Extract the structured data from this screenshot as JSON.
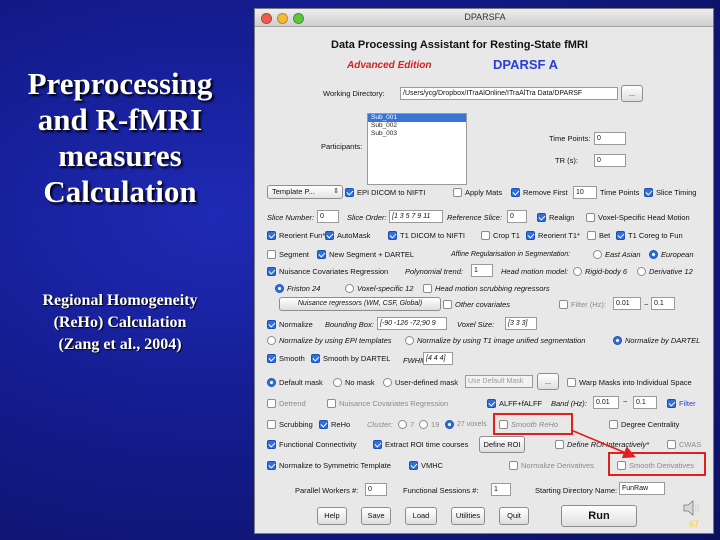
{
  "slide": {
    "title_lines": [
      "Preprocessing",
      "and R-fMRI",
      "measures",
      "Calculation"
    ],
    "subtitle_lines": [
      "Regional Homogeneity",
      "(ReHo) Calculation",
      "(Zang et al., 2004)"
    ],
    "page_number": "67"
  },
  "window": {
    "title": "DPARSFA",
    "header": "Data Processing Assistant for Resting-State fMRI",
    "edition": "Advanced Edition",
    "app_name": "DPARSF A",
    "colors": {
      "edition": "#d42020",
      "app_name": "#2a3fd6",
      "accent_check": "#2f6fe0",
      "highlight": "#e11f1f"
    }
  },
  "working_dir": {
    "label": "Working Directory:",
    "value": "/Users/ycg/Dropbox/ITraAlOnline/ITraAlTra Data/DPARSF",
    "browse": "..."
  },
  "participants": {
    "label": "Participants:",
    "items": [
      "Sub_001",
      "Sub_002",
      "Sub_003"
    ],
    "selected": 0
  },
  "time_points": {
    "label": "Time Points:",
    "value": "0"
  },
  "tr": {
    "label": "TR (s):",
    "value": "0"
  },
  "template": {
    "label": "Template P...",
    "icon": "chevron-updown-icon"
  },
  "row1": {
    "epi_dicom": "EPI DICOM to NIFTI",
    "apply_mats": "Apply Mats",
    "remove_first": "Remove First",
    "remove_value": "10",
    "time_points_lbl": "Time Points",
    "slice_timing": "Slice Timing"
  },
  "row2": {
    "slice_number": "Slice Number:",
    "slice_number_val": "0",
    "slice_order": "Slice Order:",
    "slice_order_val": "[1 3 5 7 9 11",
    "reference_slice": "Reference Slice:",
    "reference_val": "0",
    "realign": "Realign",
    "voxel_head": "Voxel-Specific Head Motion"
  },
  "row3": {
    "reorient_fun": "Reorient Fun*",
    "automask": "AutoMask",
    "t1_dicom": "T1 DICOM to NIFTI",
    "crop_t1": "Crop T1",
    "reorient_t1": "Reorient T1*",
    "bet": "Bet",
    "t1_coreg": "T1 Coreg to Fun"
  },
  "row4": {
    "segment": "Segment",
    "new_segment": "New Segment + DARTEL",
    "affine_label": "Affine Regularisation in Segmentation:",
    "east_asian": "East Asian",
    "european": "European"
  },
  "row5": {
    "nuisance": "Nuisance Covariates Regression",
    "polynomial": "Polynomial trend:",
    "poly_val": "1",
    "head_motion": "Head motion model:",
    "rigid6": "Rigid-body 6",
    "derivative12": "Derivative 12"
  },
  "row6": {
    "friston24": "Friston 24",
    "voxel12": "Voxel-specific 12",
    "head_scrub": "Head motion scrubbing regressors"
  },
  "row7": {
    "nuisance_regs": "Nuisance regressors (WM, CSF, Global)",
    "other_cov": "Other covariates",
    "filter": "Filter (Hz):",
    "filter_low": "0.01",
    "filter_sep": "~",
    "filter_high": "0.1"
  },
  "row8": {
    "normalize": "Normalize",
    "bounding_box": "Bounding Box:",
    "bbox_val": "[-90 -126 -72;90 9",
    "voxel_size": "Voxel Size:",
    "voxel_val": "[3 3 3]"
  },
  "row9": {
    "norm_epi": "Normalize by using EPI templates",
    "norm_t1": "Normalize by using T1 image unified segmentation",
    "norm_dartel": "Normalize by DARTEL"
  },
  "row10": {
    "smooth": "Smooth",
    "smooth_dartel": "Smooth by DARTEL",
    "fwhm": "FWHM:",
    "fwhm_val": "[4 4 4]"
  },
  "row11": {
    "default_mask": "Default mask",
    "no_mask": "No mask",
    "user_mask": "User-defined mask",
    "use_default": "Use Default Mask",
    "browse": "...",
    "warp": "Warp Masks into Individual Space"
  },
  "row12": {
    "detrend": "Detrend",
    "nuisance2": "Nuisance Covariates Regression",
    "alff": "ALFF+fALFF",
    "band": "Band (Hz):",
    "band_low": "0.01",
    "band_sep": "~",
    "band_high": "0.1",
    "filter": "Filter"
  },
  "row13": {
    "scrubbing": "Scrubbing",
    "reho": "ReHo",
    "cluster": "Cluster:",
    "c7": "7",
    "c19": "19",
    "c27": "27 voxels",
    "smooth_reho": "Smooth ReHo",
    "degree": "Degree Centrality"
  },
  "row14": {
    "fc": "Functional Connectivity",
    "extract_roi": "Extract ROI time courses",
    "define_roi": "Define ROI",
    "define_roi_interactive": "Define ROI Interactively*",
    "cwas": "CWAS"
  },
  "row15": {
    "normalize_sym": "Normalize to Symmetric Template",
    "vmhc": "VMHC",
    "normalize_deriv": "Normalize Derivatives",
    "smooth_deriv": "Smooth Derivatives"
  },
  "row16": {
    "parallel": "Parallel Workers #:",
    "parallel_val": "0",
    "sessions": "Functional Sessions #:",
    "sessions_val": "1",
    "start_dir": "Starting Directory Name:",
    "start_dir_val": "FunRaw"
  },
  "buttons": {
    "help": "Help",
    "save": "Save",
    "load": "Load",
    "utilities": "Utilities",
    "quit": "Quit",
    "run": "Run"
  }
}
